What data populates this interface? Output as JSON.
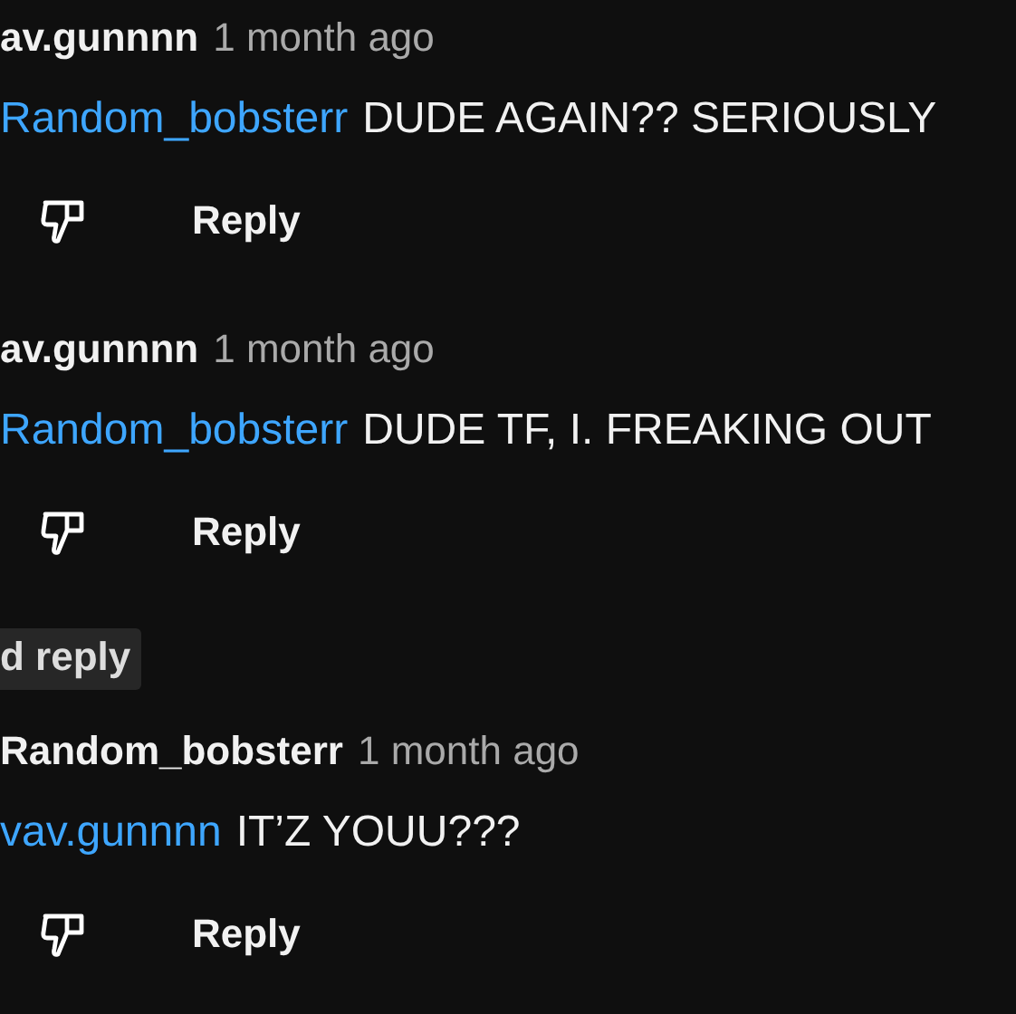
{
  "items": [
    {
      "kind": "comment",
      "author": "av.gunnnn",
      "time": "1 month ago",
      "mention": "Random_bobsterr",
      "text": "DUDE AGAIN?? SERIOUSLY",
      "reply_label": "Reply"
    },
    {
      "kind": "comment",
      "author": "av.gunnnn",
      "time": "1 month ago",
      "mention": "Random_bobsterr",
      "text": "DUDE TF, I. FREAKING OUT",
      "reply_label": "Reply"
    },
    {
      "kind": "chip",
      "label": "d reply"
    },
    {
      "kind": "comment",
      "author": "Random_bobsterr",
      "time": "1 month ago",
      "mention": "vav.gunnnn",
      "text": "IT’Z YOUU???",
      "reply_label": "Reply"
    }
  ]
}
